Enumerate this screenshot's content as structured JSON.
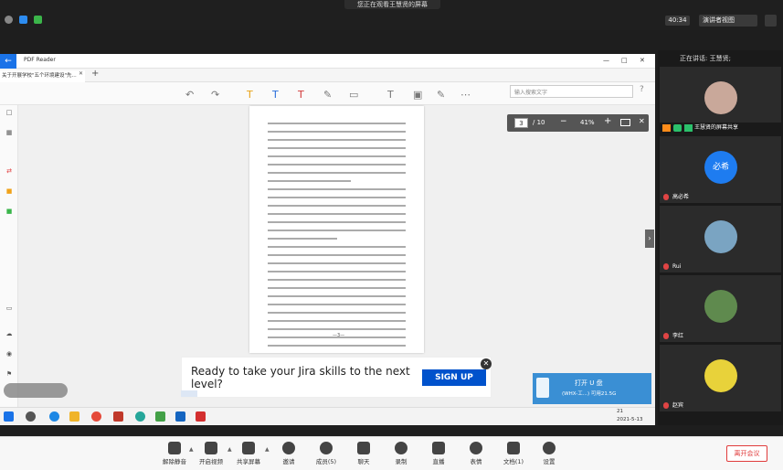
{
  "topbar": {
    "sharing_banner": "您正在观看王慧贤的屏幕",
    "timer": "40:34",
    "view_button": "演讲者视图"
  },
  "pdf_app": {
    "app_name": "PDF Reader",
    "doc_tab": "关于开展学校\"五个环境建设\"先...",
    "search_placeholder": "输入搜索文字",
    "page_current": "3",
    "page_total": "/ 10",
    "zoom": "41%",
    "page_footer": "—3—"
  },
  "ad": {
    "text": "Ready to take your Jira skills to the next level?",
    "button": "SIGN UP"
  },
  "usb_popup": {
    "title": "打开 U 盘",
    "subtitle": "(WHX-工...)    可用21.5G"
  },
  "taskbar": {
    "time": "21",
    "date": "2021-5-13"
  },
  "panel": {
    "speaking": "正在讲话: 王慧贤;",
    "tiles": [
      {
        "name": "王慧贤的屏幕共享",
        "avatar_color": "#c9a89a"
      },
      {
        "name": "高必希",
        "avatar_text": "必希",
        "avatar_color": "#1e7cf0"
      },
      {
        "name": "Rui",
        "avatar_color": "#7aa4c2"
      },
      {
        "name": "李红",
        "avatar_color": "#5f8a4e"
      },
      {
        "name": "赵宾",
        "avatar_color": "#e8d23a"
      }
    ]
  },
  "controls": {
    "mute": "解除静音",
    "video": "开启视频",
    "share": "共享屏幕",
    "invite": "邀请",
    "members": "成员(5)",
    "chat": "聊天",
    "record": "录制",
    "live": "直播",
    "reactions": "表情",
    "docs": "文档(1)",
    "settings": "设置",
    "leave": "离开会议"
  }
}
